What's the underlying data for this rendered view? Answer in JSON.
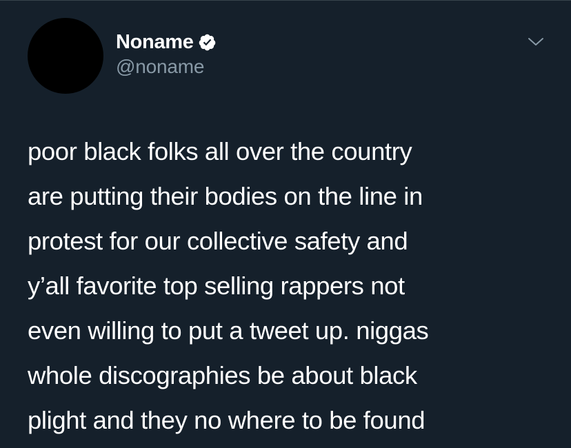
{
  "author": {
    "display_name": "Noname",
    "handle": "@noname",
    "verified_icon": "verified-badge-icon"
  },
  "menu": {
    "icon": "chevron-down-icon"
  },
  "tweet": {
    "lines": [
      "poor black folks all over the country",
      "are putting their bodies on the line in",
      "protest for our collective safety and",
      "y’all favorite top selling rappers not",
      "even willing to put a tweet up. niggas",
      "whole discographies be about black",
      "plight and they no where to be found"
    ]
  },
  "colors": {
    "background": "#15202b",
    "text": "#ffffff",
    "secondary_text": "#8899a6",
    "divider": "#38444d"
  }
}
